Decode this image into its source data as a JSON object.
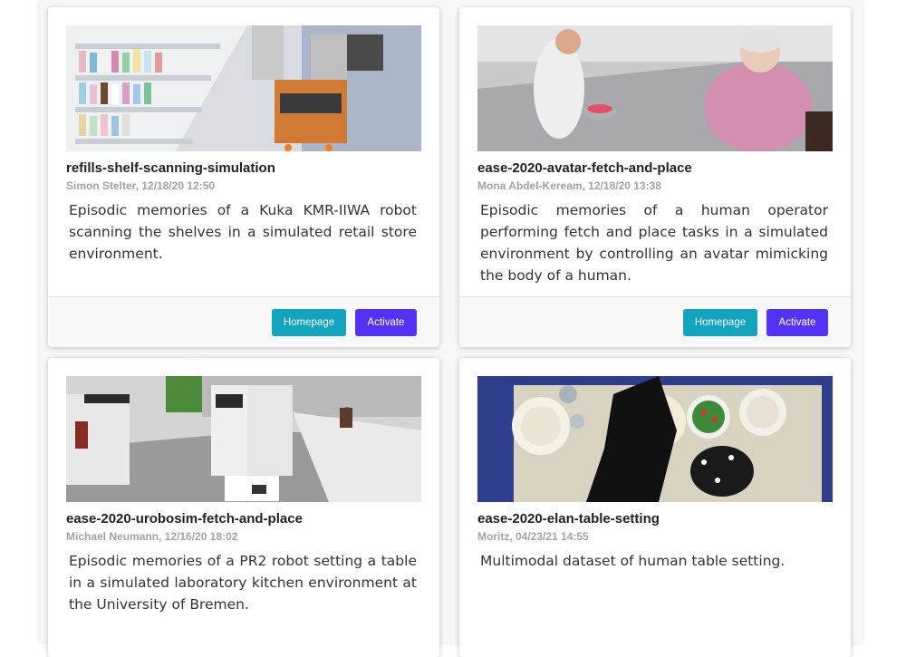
{
  "cards": [
    {
      "title": "refills-shelf-scanning-simulation",
      "meta": "Simon Stelter, 12/18/20 12:50",
      "description": "Episodic memories of a Kuka KMR-IIWA robot scanning the shelves in a simulated retail store environment.",
      "homepage_label": "Homepage",
      "activate_label": "Activate"
    },
    {
      "title": "ease-2020-avatar-fetch-and-place",
      "meta": "Mona Abdel-Keream, 12/18/20 13:38",
      "description": "Episodic memories of a human operator performing fetch and place tasks in a simulated environment by controlling an avatar mimicking the body of a human.",
      "homepage_label": "Homepage",
      "activate_label": "Activate"
    },
    {
      "title": "ease-2020-urobosim-fetch-and-place",
      "meta": "Michael Neumann, 12/16/20 18:02",
      "description": "Episodic memories of a PR2 robot setting a table in a simulated laboratory kitchen environment at the University of Bremen."
    },
    {
      "title": "ease-2020-elan-table-setting",
      "meta": "Moritz, 04/23/21 14:55",
      "description": "Multimodal dataset of human table setting."
    }
  ],
  "colors": {
    "homepage_button": "#12a3bf",
    "activate_button": "#5531f5"
  }
}
